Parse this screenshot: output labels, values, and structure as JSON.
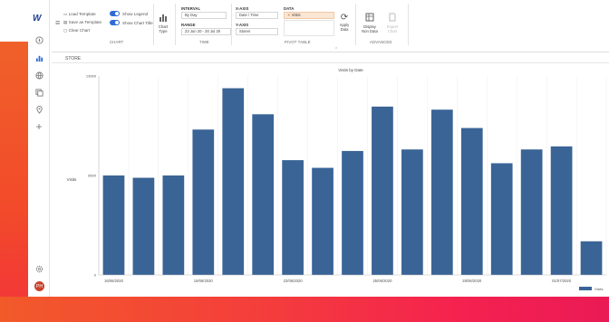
{
  "app": {
    "logo": "W"
  },
  "sidebar": {
    "icons": [
      "compass-icon",
      "bar-chart-icon",
      "globe-icon",
      "copy-icon",
      "location-pin-icon",
      "plus-icon",
      "settings-icon"
    ],
    "avatar_text": "PH"
  },
  "ribbon": {
    "chart_group": {
      "load_template": "Load Template",
      "save_as_template": "Save as Template",
      "clear_chart": "Clear Chart",
      "show_legend": "Show Legend",
      "show_chart_title": "Show Chart Title",
      "label": "CHART"
    },
    "chart_type": {
      "label": "Chart\nType"
    },
    "time_group": {
      "interval_head": "INTERVAL",
      "interval_value": "By Day",
      "range_head": "RANGE",
      "range_value": "23 Jun 20 - 20 Jul 20",
      "label": "TIME"
    },
    "pivot_group": {
      "xaxis_head": "X-AXIS",
      "xaxis_value": "Date / Time",
      "yaxis_head": "Y-AXIS",
      "yaxis_value": "Stores",
      "data_head": "DATA",
      "data_value": "Visits",
      "label": "PIVOT TABLE"
    },
    "apply_data": "Apply\nData",
    "display_hint": "Display\nNon Data",
    "export": "Export\nChart",
    "advanced_label": "ADVANCED"
  },
  "content": {
    "store_label": "STORE"
  },
  "chart_data": {
    "type": "bar",
    "title": "Visits by Date",
    "ylabel": "Visits",
    "ylim": [
      0,
      13000
    ],
    "yticks": [
      0,
      6500,
      13000
    ],
    "ytick_labels": [
      "0",
      "6500",
      "13000"
    ],
    "x_tick_labels": [
      "16/06/2020",
      "19/06/2020",
      "22/06/2020",
      "25/06/2020",
      "28/06/2020",
      "01/07/2020"
    ],
    "x_tick_indices": [
      0,
      3,
      6,
      9,
      12,
      15
    ],
    "values": [
      6500,
      6350,
      6500,
      9500,
      12200,
      10500,
      7500,
      7000,
      8100,
      11000,
      8200,
      10800,
      9600,
      7300,
      8200,
      8400,
      2200
    ],
    "legend": [
      "Visits"
    ],
    "color": "#3a6496"
  }
}
